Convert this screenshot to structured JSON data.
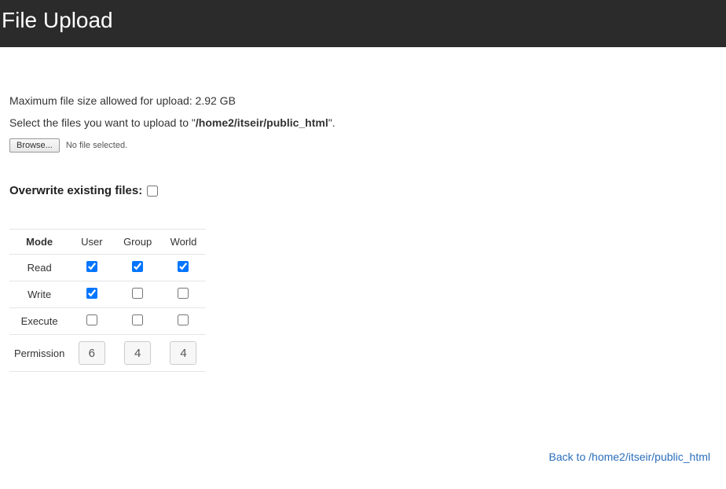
{
  "header": {
    "title": "File Upload"
  },
  "info": {
    "max_size_text": "Maximum file size allowed for upload: 2.92 GB",
    "select_prefix": "Select the files you want to upload to \"",
    "select_path": "/home2/itseir/public_html",
    "select_suffix": "\"."
  },
  "file": {
    "browse_label": "Browse...",
    "no_file_text": "No file selected."
  },
  "overwrite": {
    "label": "Overwrite existing files:",
    "checked": false
  },
  "permissions_table": {
    "headers": {
      "mode": "Mode",
      "user": "User",
      "group": "Group",
      "world": "World"
    },
    "rows": {
      "read": {
        "label": "Read",
        "user": true,
        "group": true,
        "world": true
      },
      "write": {
        "label": "Write",
        "user": true,
        "group": false,
        "world": false
      },
      "execute": {
        "label": "Execute",
        "user": false,
        "group": false,
        "world": false
      }
    },
    "permission_label": "Permission",
    "permission_values": {
      "user": "6",
      "group": "4",
      "world": "4"
    }
  },
  "back_link": {
    "prefix": "Back to ",
    "path": "/home2/itseir/public_html"
  }
}
